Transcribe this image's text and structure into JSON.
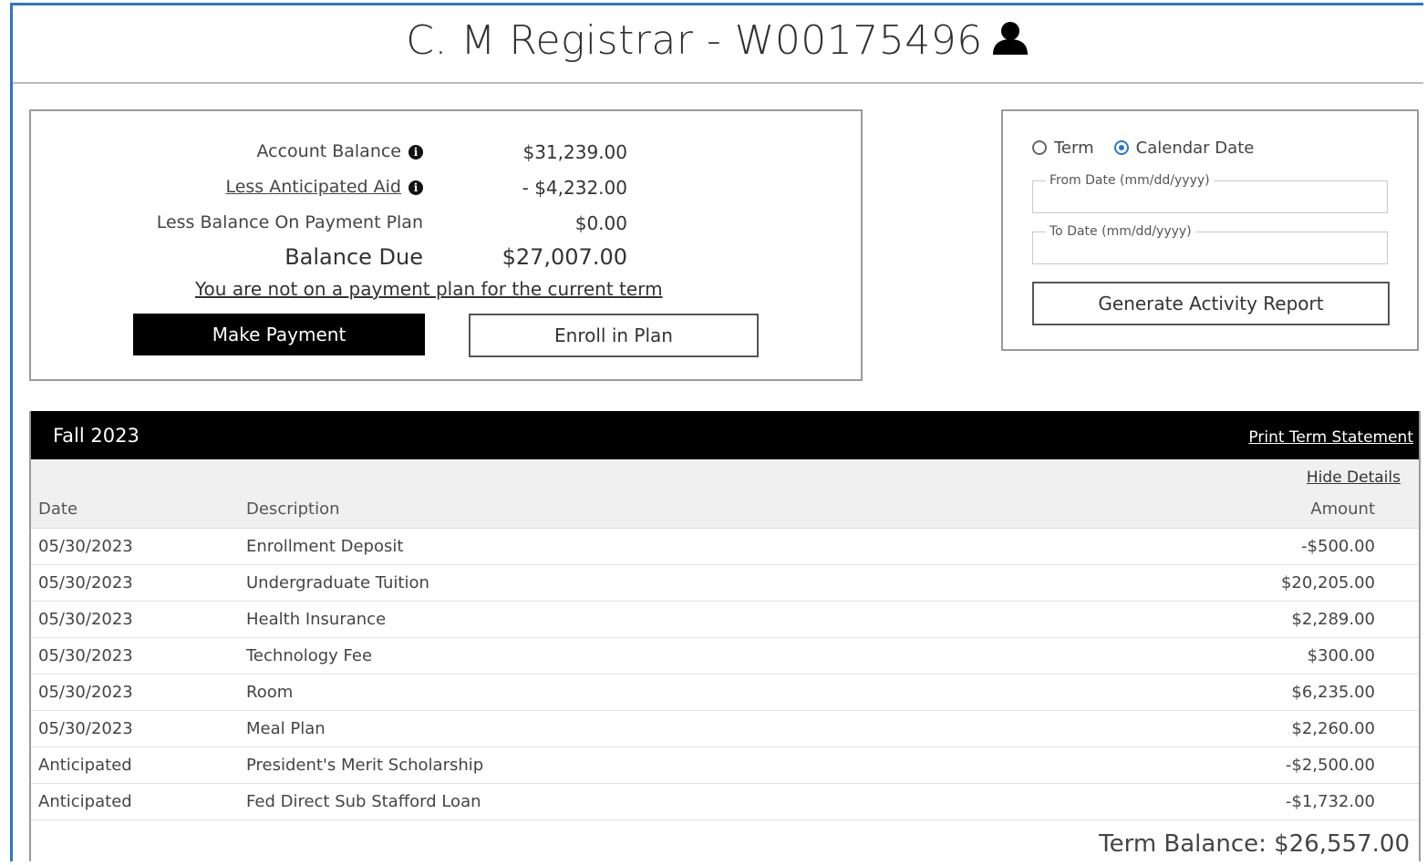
{
  "header": {
    "title": "C. M Registrar - W00175496",
    "user_icon": "user-icon"
  },
  "balance": {
    "account_balance_label": "Account Balance",
    "account_balance_value": "$31,239.00",
    "anticipated_aid_label": "Less Anticipated Aid",
    "anticipated_aid_value": "- $4,232.00",
    "payment_plan_label": "Less Balance On Payment Plan",
    "payment_plan_value": "$0.00",
    "balance_due_label": "Balance Due",
    "balance_due_value": "$27,007.00",
    "plan_notice": "You are not on a payment plan for the current term",
    "make_payment_label": "Make Payment",
    "enroll_label": "Enroll in Plan"
  },
  "report": {
    "term_option": "Term",
    "calendar_option": "Calendar Date",
    "selected_option": "Calendar Date",
    "from_label": "From Date (mm/dd/yyyy)",
    "from_value": "",
    "to_label": "To Date (mm/dd/yyyy)",
    "to_value": "",
    "generate_label": "Generate Activity Report"
  },
  "term": {
    "name": "Fall 2023",
    "print_label": "Print Term Statement",
    "hide_label": "Hide Details",
    "columns": {
      "date": "Date",
      "description": "Description",
      "amount": "Amount"
    },
    "rows": [
      {
        "date": "05/30/2023",
        "description": "Enrollment Deposit",
        "amount": "-$500.00"
      },
      {
        "date": "05/30/2023",
        "description": "Undergraduate Tuition",
        "amount": "$20,205.00"
      },
      {
        "date": "05/30/2023",
        "description": "Health Insurance",
        "amount": "$2,289.00"
      },
      {
        "date": "05/30/2023",
        "description": "Technology Fee",
        "amount": "$300.00"
      },
      {
        "date": "05/30/2023",
        "description": "Room",
        "amount": "$6,235.00"
      },
      {
        "date": "05/30/2023",
        "description": "Meal Plan",
        "amount": "$2,260.00"
      },
      {
        "date": "Anticipated",
        "description": "President's Merit Scholarship",
        "amount": "-$2,500.00"
      },
      {
        "date": "Anticipated",
        "description": "Fed Direct Sub Stafford Loan",
        "amount": "-$1,732.00"
      }
    ],
    "term_balance": "Term Balance: $26,557.00"
  },
  "colors": {
    "accent": "#2b77c7",
    "header_bar": "#000000",
    "button_primary": "#000000"
  }
}
